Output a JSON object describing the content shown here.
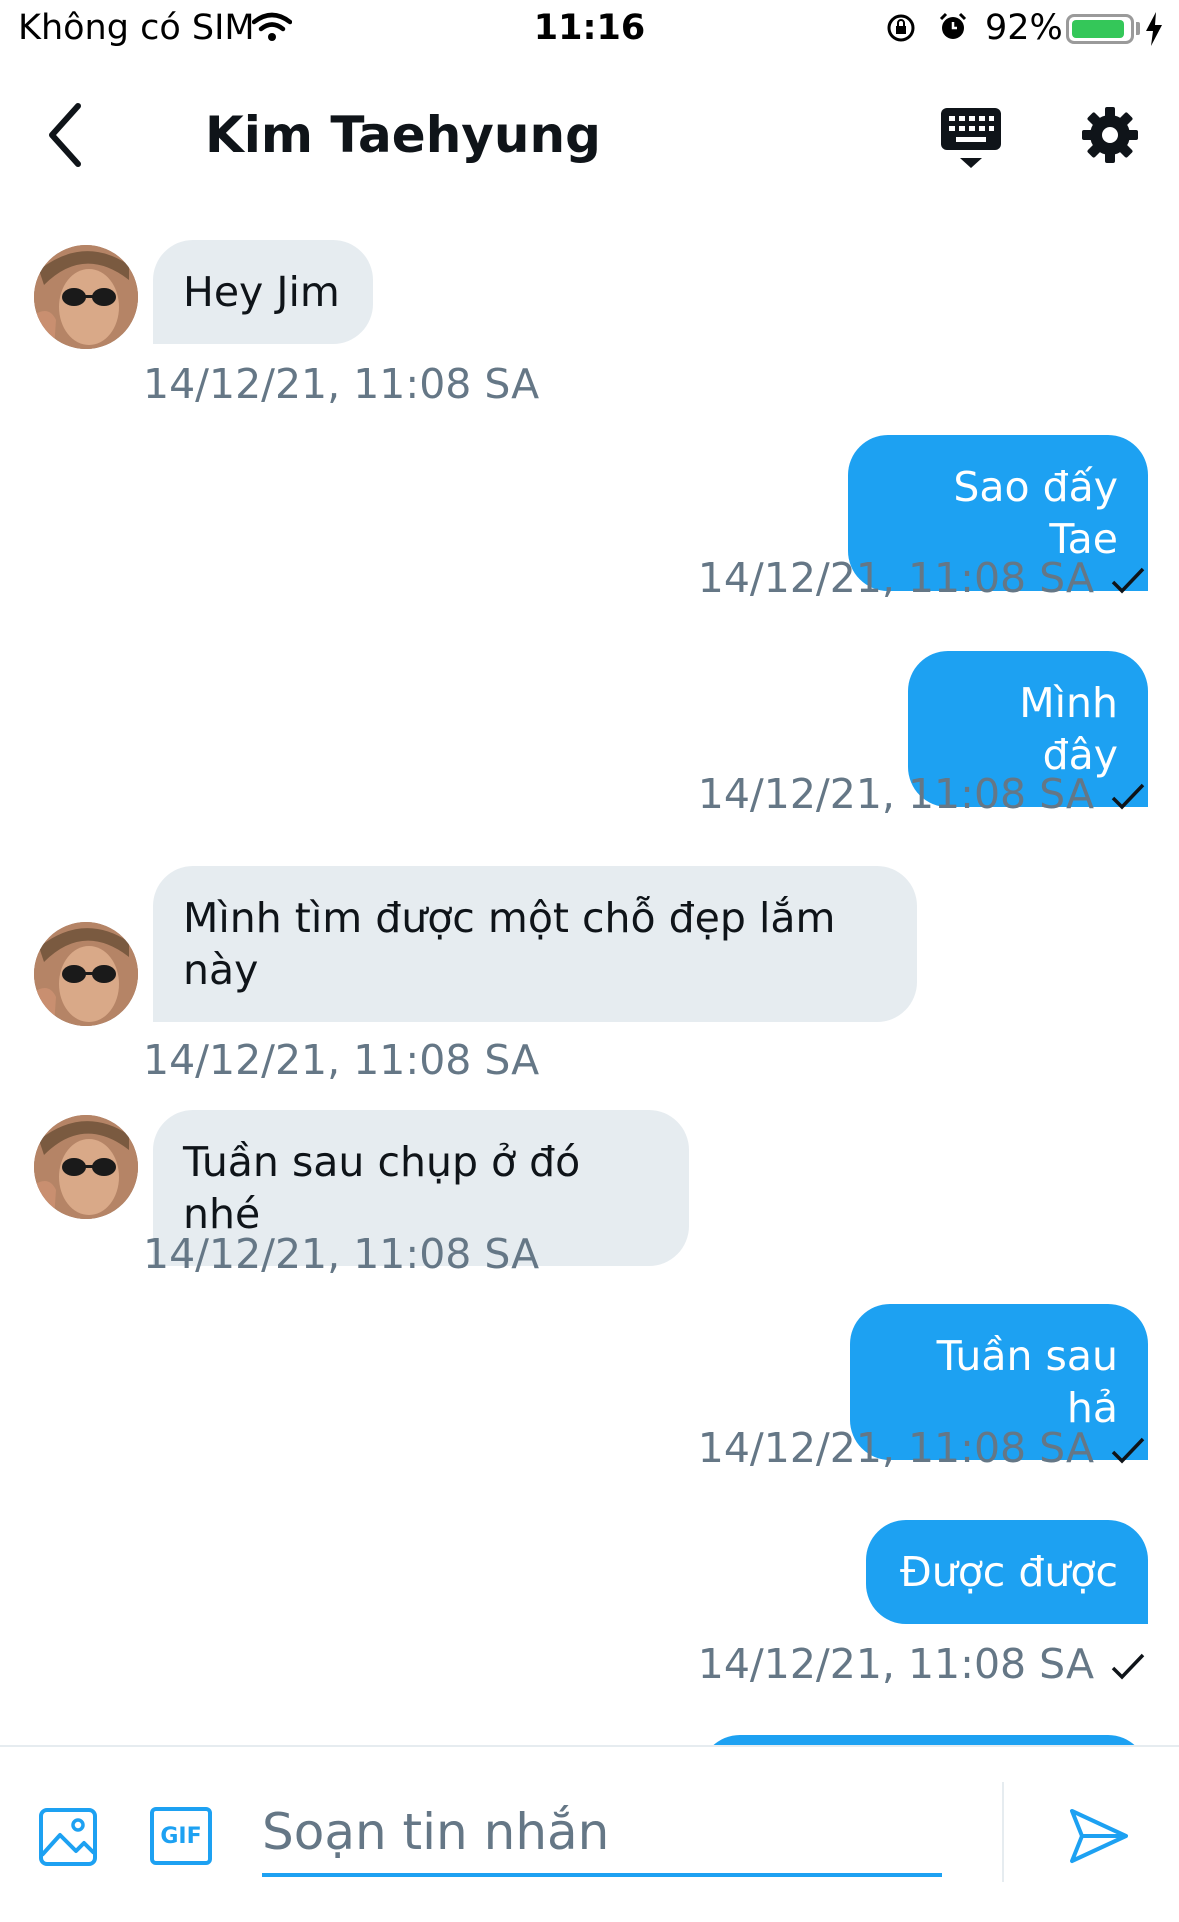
{
  "status_bar": {
    "carrier": "Không có SIM",
    "time": "11:16",
    "battery_percent": "92%",
    "battery_level": 0.92,
    "icons": [
      "wifi-icon",
      "orientation-lock-icon",
      "alarm-icon",
      "battery-icon",
      "charging-bolt-icon"
    ]
  },
  "header": {
    "title": "Kim Taehyung",
    "back_icon": "chevron-left-icon",
    "keyboard_icon": "keyboard-icon",
    "settings_icon": "gear-icon"
  },
  "messages": [
    {
      "direction": "in",
      "text": "Hey Jim",
      "timestamp": "14/12/21, 11:08 SA"
    },
    {
      "direction": "out",
      "text": "Sao đấy Tae",
      "timestamp": "14/12/21, 11:08 SA",
      "status": "sent-check"
    },
    {
      "direction": "out",
      "text": "Mình đây",
      "timestamp": "14/12/21, 11:08 SA",
      "status": "sent-check"
    },
    {
      "direction": "in",
      "text": "Mình tìm được một chỗ đẹp lắm này",
      "timestamp": "14/12/21, 11:08 SA"
    },
    {
      "direction": "in",
      "text": "Tuần sau chụp ở đó nhé",
      "timestamp": "14/12/21, 11:08 SA"
    },
    {
      "direction": "out",
      "text": "Tuần sau hả",
      "timestamp": "14/12/21, 11:08 SA",
      "status": "sent-check"
    },
    {
      "direction": "out",
      "text": "Được được",
      "timestamp": "14/12/21, 11:08 SA",
      "status": "sent-check"
    },
    {
      "direction": "out",
      "text": "",
      "partial": true
    }
  ],
  "composer": {
    "placeholder": "Soạn tin nhắn",
    "value": "",
    "image_icon": "image-icon",
    "gif_label": "GIF",
    "send_icon": "send-icon"
  },
  "colors": {
    "accent": "#1da1f2",
    "incoming_bubble": "#e6ecf0",
    "timestamp": "#657786",
    "battery": "#34c759"
  }
}
